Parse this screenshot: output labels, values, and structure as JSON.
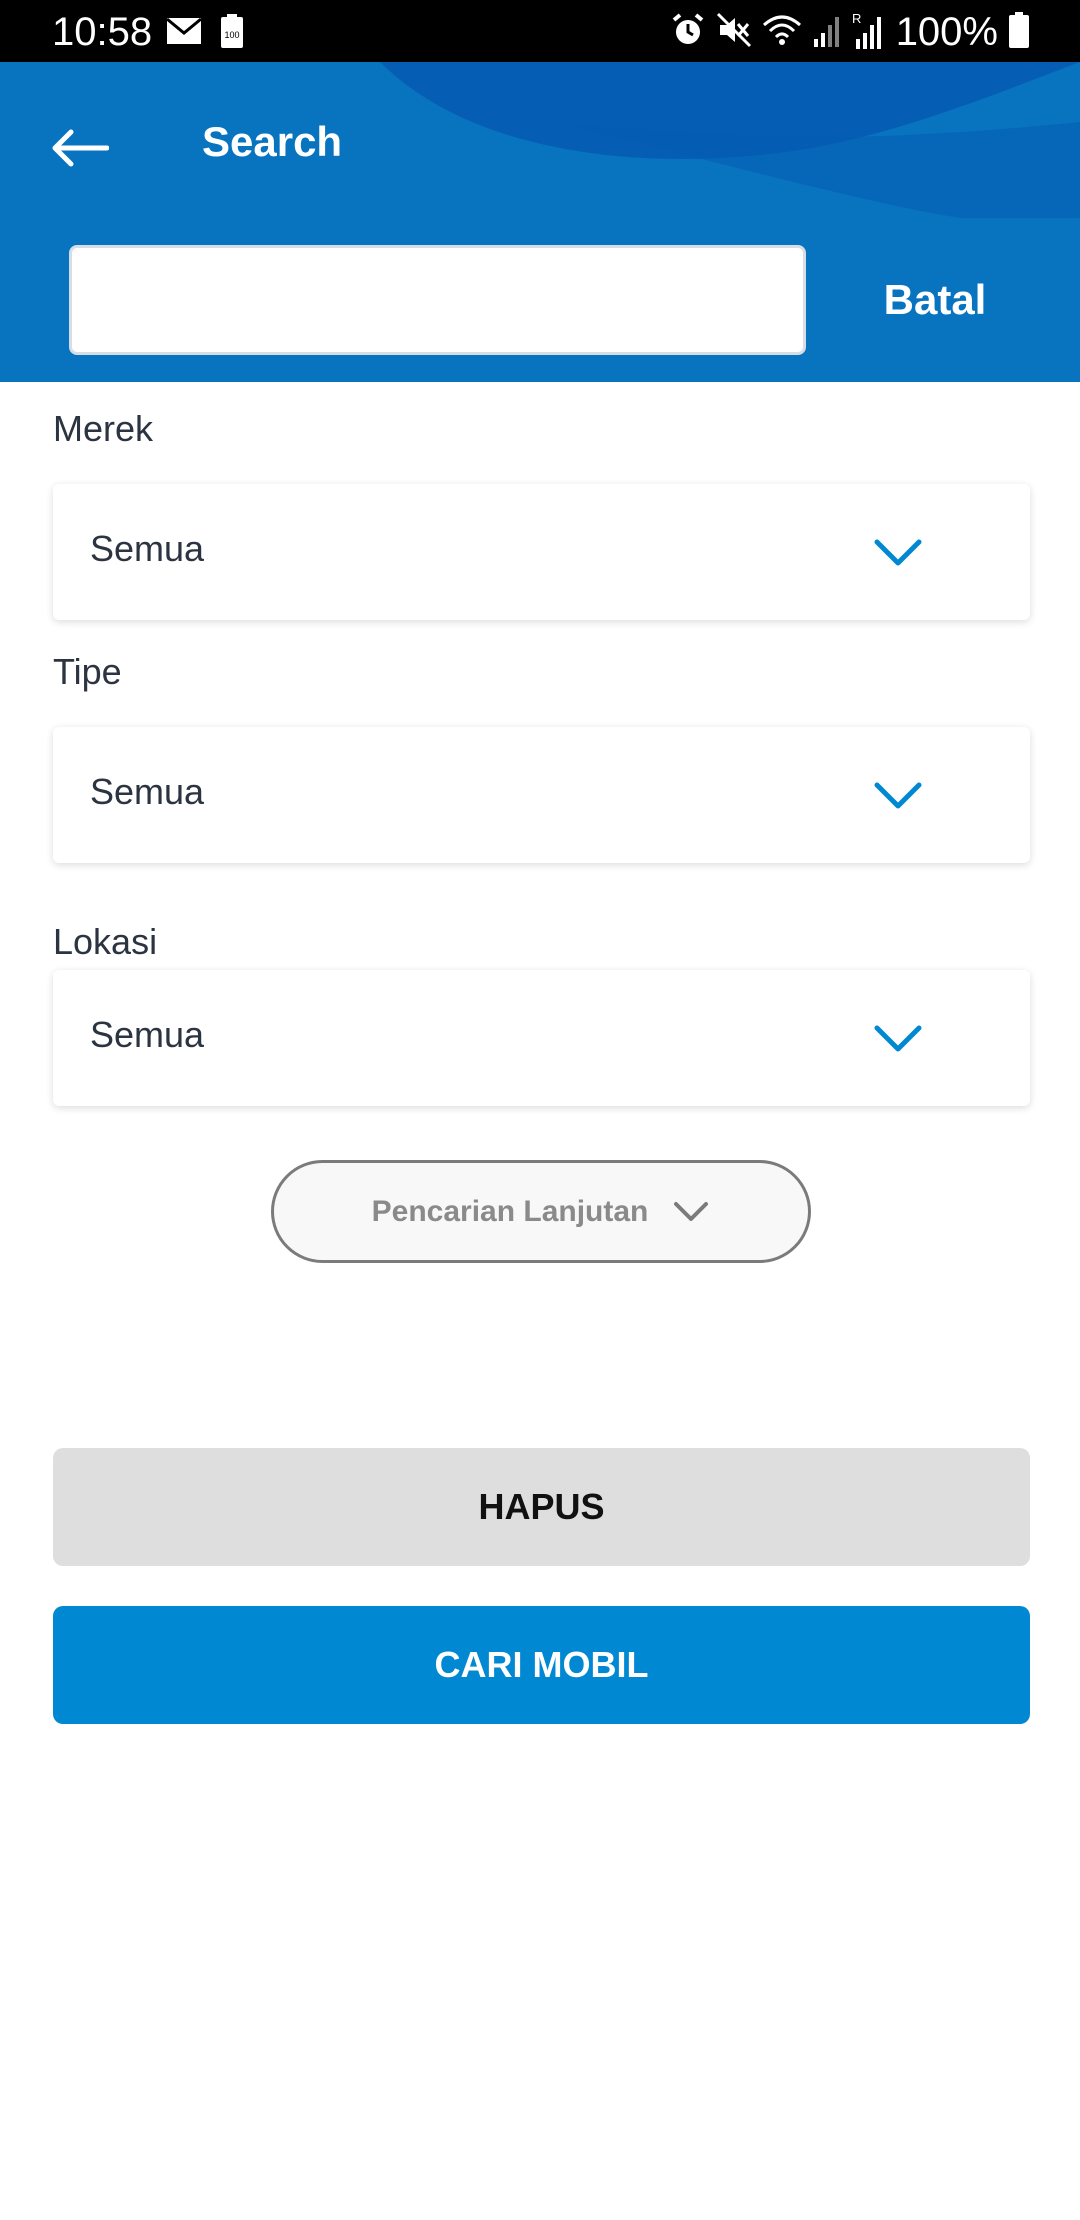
{
  "status_bar": {
    "time": "10:58",
    "battery_text": "100%",
    "left_icons": [
      "mail-icon",
      "battery-saver-icon"
    ],
    "right_icons": [
      "alarm-icon",
      "mute-icon",
      "wifi-icon",
      "signal-icon",
      "roaming-signal-icon",
      "battery-icon"
    ]
  },
  "header": {
    "title": "Search",
    "cancel_label": "Batal",
    "search_value": "",
    "back_icon": "arrow-left-icon",
    "background_color": "#0874c0"
  },
  "form": {
    "fields": [
      {
        "label": "Merek",
        "value": "Semua"
      },
      {
        "label": "Tipe",
        "value": "Semua"
      },
      {
        "label": "Lokasi",
        "value": "Semua"
      }
    ],
    "chevron_color": "#0089d2",
    "advanced_label": "Pencarian Lanjutan"
  },
  "actions": {
    "clear_label": "HAPUS",
    "search_label": "CARI MOBIL",
    "search_color": "#0089d2",
    "clear_color": "#dedede"
  }
}
